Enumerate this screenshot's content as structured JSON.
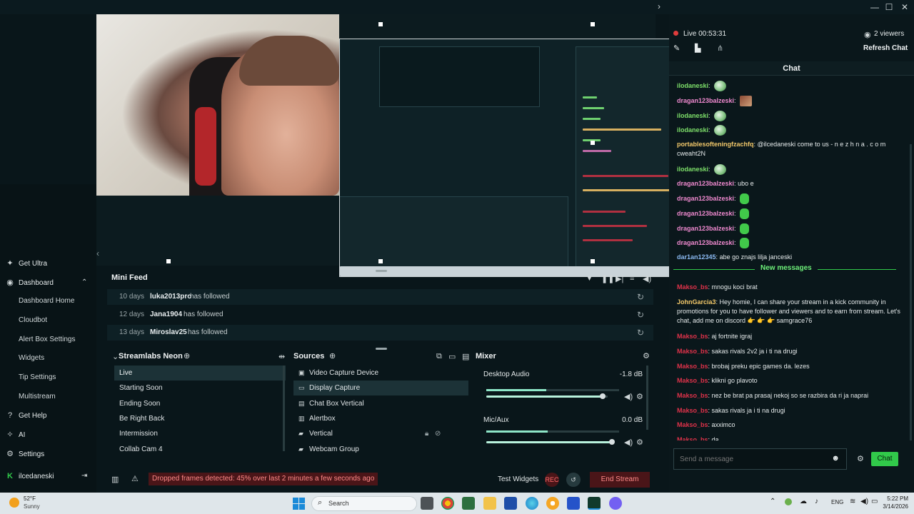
{
  "window": {
    "minimize": "—",
    "maximize": "☐",
    "close": "✕",
    "collapse": "›"
  },
  "sidebar": {
    "get_ultra": "Get Ultra",
    "dashboard": "Dashboard",
    "dashboard_items": [
      "Dashboard Home",
      "Cloudbot",
      "Alert Box Settings",
      "Widgets",
      "Tip Settings",
      "Multistream"
    ],
    "get_help": "Get Help",
    "ai": "AI",
    "settings": "Settings",
    "user": "ilcedaneski"
  },
  "mini_feed": {
    "title": "Mini Feed",
    "rows": [
      {
        "time": "10 days",
        "user": "luka2013pro",
        "text": "has followed"
      },
      {
        "time": "12 days",
        "user": "Jana1904",
        "text": "has followed"
      },
      {
        "time": "13 days",
        "user": "Miroslav25",
        "text": "has followed"
      }
    ]
  },
  "scenes": {
    "title": "Streamlabs Neon",
    "items": [
      "Live",
      "Starting Soon",
      "Ending Soon",
      "Be Right Back",
      "Intermission",
      "Collab Cam 4"
    ],
    "active": "Live"
  },
  "sources": {
    "title": "Sources",
    "items": [
      "Video Capture Device",
      "Display Capture",
      "Chat Box Vertical",
      "Alertbox",
      "Vertical",
      "Webcam Group"
    ],
    "active": "Display Capture"
  },
  "mixer": {
    "title": "Mixer",
    "channels": [
      {
        "name": "Desktop Audio",
        "db": "-1.8 dB",
        "meter": 0.45,
        "volume": 0.96
      },
      {
        "name": "Mic/Aux",
        "db": "0.0 dB",
        "meter": 0.46,
        "volume": 1.0
      }
    ]
  },
  "status": {
    "dropped": "Dropped frames detected: 45% over last 2 minutes a few seconds ago",
    "test_widgets": "Test Widgets",
    "rec": "REC",
    "end_stream": "End Stream"
  },
  "chat": {
    "live_time": "Live 00:53:31",
    "viewers": "2 viewers",
    "refresh": "Refresh Chat",
    "title": "Chat",
    "messages": [
      {
        "user": "ilodaneski",
        "text": "",
        "emote": "face",
        "color": "#7ee06a"
      },
      {
        "user": "dragan123balzeski",
        "text": "",
        "emote": "photo",
        "color": "#f08ad0"
      },
      {
        "user": "ilodaneski",
        "text": "",
        "emote": "face",
        "color": "#7ee06a"
      },
      {
        "user": "ilodaneski",
        "text": "",
        "emote": "face",
        "color": "#7ee06a"
      },
      {
        "user": "portablesofteningfzachfq",
        "text": "@ilcedaneski come to us - n e z h n a . c o m cweaht2N",
        "emote": "",
        "color": "#f2c86a"
      },
      {
        "user": "ilodaneski",
        "text": "",
        "emote": "face",
        "color": "#7ee06a"
      },
      {
        "user": "dragan123balzeski",
        "text": "ubo e",
        "emote": "",
        "color": "#f08ad0"
      },
      {
        "user": "dragan123balzeski",
        "text": "",
        "emote": "green",
        "color": "#f08ad0"
      },
      {
        "user": "dragan123balzeski",
        "text": "",
        "emote": "green",
        "color": "#f08ad0"
      },
      {
        "user": "dragan123balzeski",
        "text": "",
        "emote": "green",
        "color": "#f08ad0"
      },
      {
        "user": "dragan123balzeski",
        "text": "",
        "emote": "green",
        "color": "#f08ad0"
      },
      {
        "user": "dar1an12345",
        "text": "abe go znajs lilja janceski",
        "emote": "",
        "color": "#8ab8f0"
      }
    ],
    "new_messages": "New messages",
    "messages_new": [
      {
        "user": "Makso_bs",
        "text": "mnogu koci brat",
        "color": "#e0324a"
      },
      {
        "user": "JohnGarcia3",
        "text": "Hey homie, I can share your stream in a kick community in promotions for you to have follower and viewers and to earn from stream. Let's chat, add me on discord 👉 👉 👉 samgrace76",
        "color": "#f2c86a"
      },
      {
        "user": "Makso_bs",
        "text": "aj fortnite igraj",
        "color": "#e0324a"
      },
      {
        "user": "Makso_bs",
        "text": "sakas rivals 2v2 ja i ti na drugi",
        "color": "#e0324a"
      },
      {
        "user": "Makso_bs",
        "text": "brobaj preku epic games da. lezes",
        "color": "#e0324a"
      },
      {
        "user": "Makso_bs",
        "text": "klikni go plavoto",
        "color": "#e0324a"
      },
      {
        "user": "Makso_bs",
        "text": "nez be brat pa prasaj nekoj so se razbira da ri ja naprai",
        "color": "#e0324a"
      },
      {
        "user": "Makso_bs",
        "text": "sakas rivals ja i ti na drugi",
        "color": "#e0324a"
      },
      {
        "user": "Makso_bs",
        "text": "axximco",
        "color": "#e0324a"
      },
      {
        "user": "Makso_bs",
        "text": "da",
        "color": "#e0324a"
      }
    ],
    "input_placeholder": "Send a message",
    "send": "Chat"
  },
  "taskbar": {
    "weather_temp": "52°F",
    "weather_desc": "Sunny",
    "search": "Search",
    "lang": "ENG",
    "time": "5:22 PM",
    "date": "3/14/2026"
  }
}
